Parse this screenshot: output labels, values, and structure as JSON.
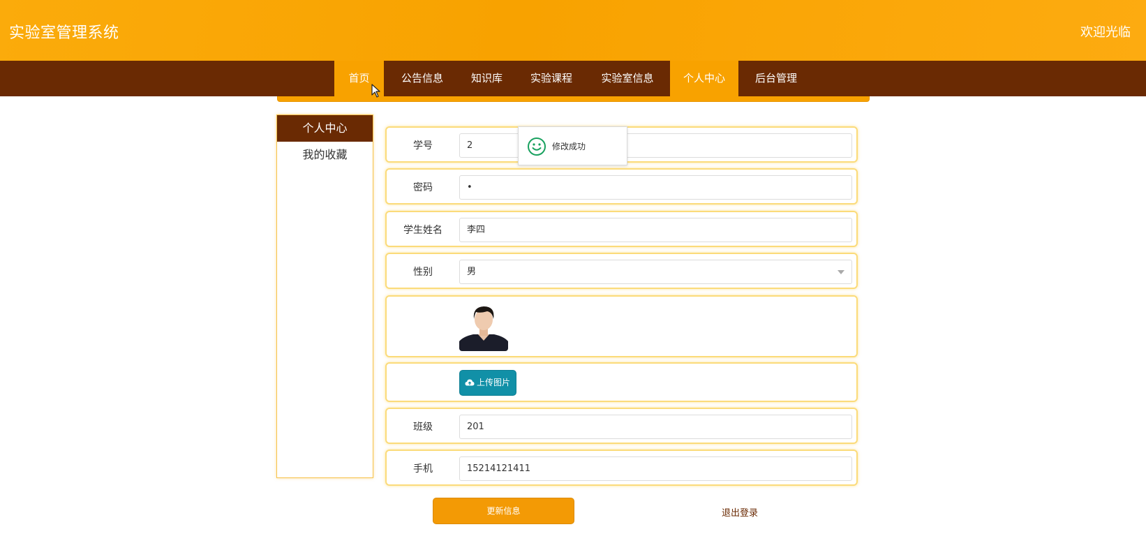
{
  "header": {
    "title": "实验室管理系统",
    "welcome": "欢迎光临"
  },
  "nav": {
    "items": [
      {
        "label": "首页"
      },
      {
        "label": "公告信息"
      },
      {
        "label": "知识库"
      },
      {
        "label": "实验课程"
      },
      {
        "label": "实验室信息"
      },
      {
        "label": "个人中心"
      },
      {
        "label": "后台管理"
      }
    ],
    "active": "个人中心"
  },
  "sidebar": {
    "items": [
      {
        "label": "个人中心"
      },
      {
        "label": "我的收藏"
      }
    ]
  },
  "form": {
    "student_id": {
      "label": "学号",
      "value": "2"
    },
    "password": {
      "label": "密码",
      "value": "•"
    },
    "student_name": {
      "label": "学生姓名",
      "value": "李四"
    },
    "gender": {
      "label": "性别",
      "value": "男"
    },
    "upload_label": "上传图片",
    "class": {
      "label": "班级",
      "value": "201"
    },
    "phone": {
      "label": "手机",
      "value": "15214121411"
    }
  },
  "toast": {
    "message": "修改成功",
    "icon": "smile-icon",
    "color": "#19a15f"
  },
  "actions": {
    "update_label": "更新信息",
    "logout_label": "退出登录"
  },
  "colors": {
    "primary_orange": "#f8a200",
    "nav_brown": "#6a2a03",
    "upload_teal": "#1190a7"
  }
}
